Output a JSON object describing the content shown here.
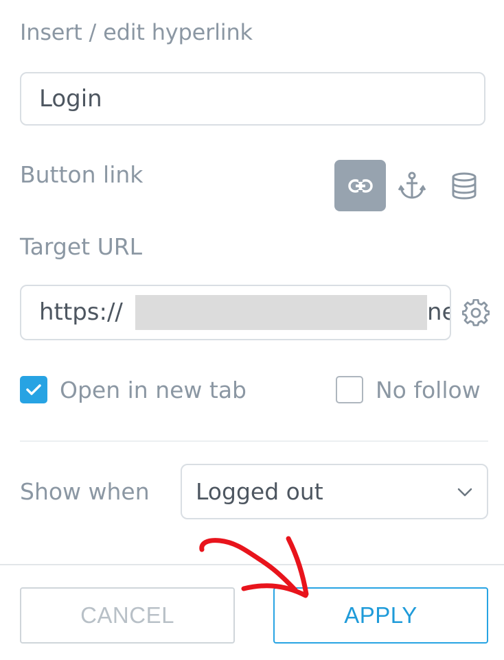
{
  "dialog": {
    "title": "Insert / edit hyperlink"
  },
  "link_text": {
    "value": "Login"
  },
  "button_link": {
    "label": "Button link",
    "types": [
      {
        "name": "url",
        "icon": "link-icon",
        "active": true
      },
      {
        "name": "anchor",
        "icon": "anchor-icon",
        "active": false
      },
      {
        "name": "data",
        "icon": "database-icon",
        "active": false
      }
    ]
  },
  "target_url": {
    "label": "Target URL",
    "value_prefix": "https://",
    "value_suffix": "ne:",
    "settings_icon": "gear-icon"
  },
  "options": {
    "open_new_tab": {
      "label": "Open in new tab",
      "checked": true
    },
    "no_follow": {
      "label": "No follow",
      "checked": false
    }
  },
  "show_when": {
    "label": "Show when",
    "selected": "Logged out"
  },
  "footer": {
    "cancel_label": "CANCEL",
    "apply_label": "APPLY"
  },
  "colors": {
    "accent": "#27a3e3",
    "annotation_arrow": "#e8141c",
    "active_type_bg": "#97a3af"
  }
}
